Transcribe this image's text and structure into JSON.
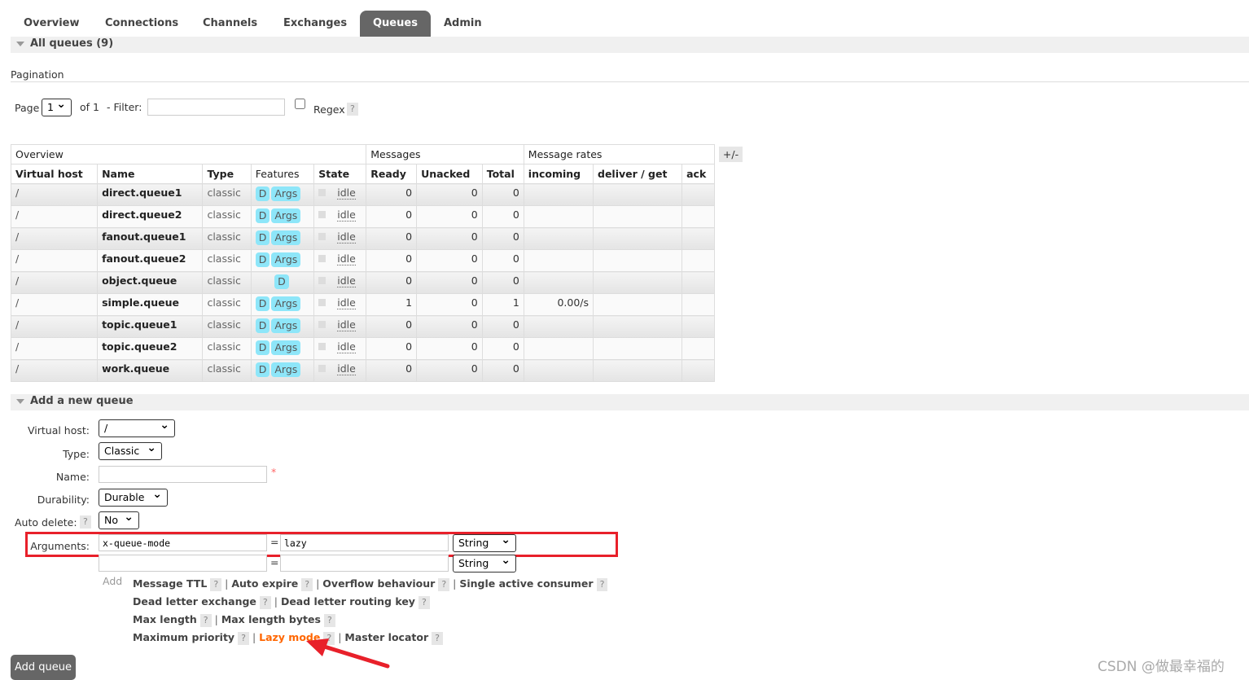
{
  "tabs": [
    "Overview",
    "Connections",
    "Channels",
    "Exchanges",
    "Queues",
    "Admin"
  ],
  "all_queues": "All queues (9)",
  "pagination": {
    "title": "Pagination",
    "page_label": "Page",
    "page": "1",
    "of": "of 1",
    "filter_label": "- Filter:",
    "regex": "Regex",
    "help": "?"
  },
  "table": {
    "groups": [
      "Overview",
      "Messages",
      "Message rates"
    ],
    "toggle": "+/-",
    "headers": [
      "Virtual host",
      "Name",
      "Type",
      "Features",
      "State",
      "Ready",
      "Unacked",
      "Total",
      "incoming",
      "deliver / get",
      "ack"
    ],
    "rows": [
      {
        "vhost": "/",
        "name": "direct.queue1",
        "type": "classic",
        "d": "D",
        "args": "Args",
        "state": "idle",
        "ready": "0",
        "unacked": "0",
        "total": "0",
        "incoming": ""
      },
      {
        "vhost": "/",
        "name": "direct.queue2",
        "type": "classic",
        "d": "D",
        "args": "Args",
        "state": "idle",
        "ready": "0",
        "unacked": "0",
        "total": "0",
        "incoming": ""
      },
      {
        "vhost": "/",
        "name": "fanout.queue1",
        "type": "classic",
        "d": "D",
        "args": "Args",
        "state": "idle",
        "ready": "0",
        "unacked": "0",
        "total": "0",
        "incoming": ""
      },
      {
        "vhost": "/",
        "name": "fanout.queue2",
        "type": "classic",
        "d": "D",
        "args": "Args",
        "state": "idle",
        "ready": "0",
        "unacked": "0",
        "total": "0",
        "incoming": ""
      },
      {
        "vhost": "/",
        "name": "object.queue",
        "type": "classic",
        "d": "D",
        "args": null,
        "state": "idle",
        "ready": "0",
        "unacked": "0",
        "total": "0",
        "incoming": ""
      },
      {
        "vhost": "/",
        "name": "simple.queue",
        "type": "classic",
        "d": "D",
        "args": "Args",
        "state": "idle",
        "ready": "1",
        "unacked": "0",
        "total": "1",
        "incoming": "0.00/s"
      },
      {
        "vhost": "/",
        "name": "topic.queue1",
        "type": "classic",
        "d": "D",
        "args": "Args",
        "state": "idle",
        "ready": "0",
        "unacked": "0",
        "total": "0",
        "incoming": ""
      },
      {
        "vhost": "/",
        "name": "topic.queue2",
        "type": "classic",
        "d": "D",
        "args": "Args",
        "state": "idle",
        "ready": "0",
        "unacked": "0",
        "total": "0",
        "incoming": ""
      },
      {
        "vhost": "/",
        "name": "work.queue",
        "type": "classic",
        "d": "D",
        "args": "Args",
        "state": "idle",
        "ready": "0",
        "unacked": "0",
        "total": "0",
        "incoming": ""
      }
    ]
  },
  "add_queue": {
    "title": "Add a new queue",
    "vhost_label": "Virtual host:",
    "vhost": "/",
    "type_label": "Type:",
    "type": "Classic",
    "name_label": "Name:",
    "name": "",
    "required": "*",
    "durability_label": "Durability:",
    "durability": "Durable",
    "auto_delete_label": "Auto delete:",
    "auto_delete": "No",
    "arguments_label": "Arguments:",
    "arg1_key": "x-queue-mode",
    "arg1_value": "lazy",
    "arg1_type": "String",
    "arg2_type": "String",
    "eq": "=",
    "add": "Add",
    "arg_links": [
      [
        "Message TTL",
        "Auto expire",
        "Overflow behaviour",
        "Single active consumer"
      ],
      [
        "Dead letter exchange",
        "Dead letter routing key"
      ],
      [
        "Max length",
        "Max length bytes"
      ],
      [
        "Maximum priority",
        "Lazy mode",
        "Master locator"
      ]
    ],
    "button": "Add queue"
  },
  "watermark": "CSDN @做最幸福的",
  "colors": {
    "highlight_box": "#e8202a",
    "arrow": "#e8202a",
    "lazy_link": "#ff6600",
    "active_tab": "#666666",
    "badge": "#8ee6f9"
  }
}
